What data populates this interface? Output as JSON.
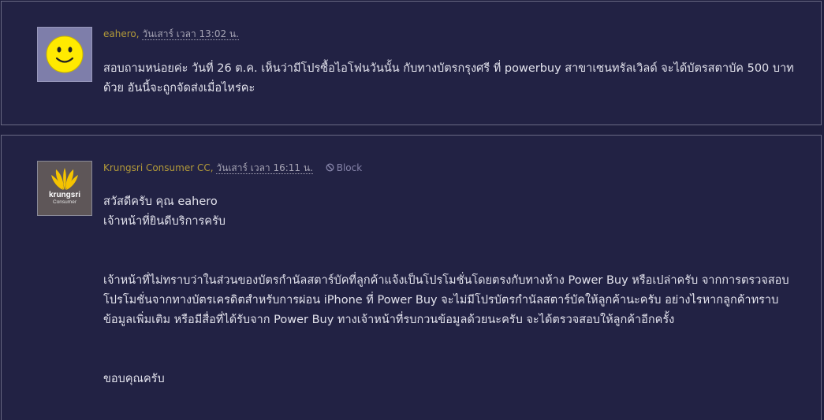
{
  "comments": [
    {
      "author": "eahero",
      "time": "วันเสาร์ เวลา 13:02 น.",
      "avatar_icon": "smiley-face-icon",
      "body": [
        "สอบถามหน่อยค่ะ วันที่ 26 ต.ค. เห็นว่ามีโปรซื้อไอโฟนวันนั้น กับทางบัตรกรุงศรี ที่ powerbuy สาขาเซนทรัลเวิลด์ จะได้บัตรสตาบัค 500 บาทด้วย อันนี้จะถูกจัดส่งเมื่อไหร่คะ"
      ]
    },
    {
      "author": "Krungsri Consumer CC",
      "time": "วันเสาร์ เวลา 16:11 น.",
      "block_label": "Block",
      "avatar_icon": "krungsri-logo-icon",
      "avatar_brand": "krungsri",
      "avatar_sub": "Consumer",
      "greeting": "สวัสดีครับ คุณ eahero",
      "intro": "เจ้าหน้าที่ยินดีบริการครับ",
      "paragraph": "เจ้าหน้าที่ไม่ทราบว่าในส่วนของบัตรกำนัลสตาร์บัคที่ลูกค้าแจ้งเป็นโปรโมชั่นโดยตรงกับทางห้าง Power Buy หรือเปล่าครับ จากการตรวจสอบโปรโมชั่นจากทางบัตรเครดิตสำหรับการผ่อน iPhone ที่ Power Buy จะไม่มีโปรบัตรกำนัลสตาร์บัคให้ลูกค้านะครับ อย่างไรหากลูกค้าทราบข้อมูลเพิ่มเติม หรือมีสื่อที่ได้รับจาก Power Buy ทางเจ้าหน้าที่รบกวนข้อมูลด้วยนะครับ จะได้ตรวจสอบให้ลูกค้าอีกครั้ง",
      "closing": "ขอบคุณครับ"
    }
  ],
  "colors": {
    "background": "#1f1f3f",
    "card": "#222244",
    "author": "#b39a39",
    "text": "#e2e2ec",
    "smiley": "#ffea00",
    "krungsri_yellow": "#f5c400"
  }
}
